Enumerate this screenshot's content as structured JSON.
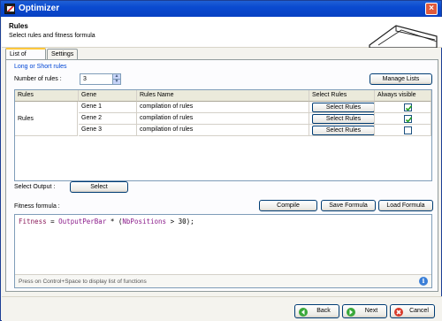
{
  "window": {
    "title": "Optimizer",
    "close_glyph": "×"
  },
  "header": {
    "title": "Rules",
    "subtitle": "Select rules and fitness formula"
  },
  "tabs": [
    {
      "label": "List of Rules"
    },
    {
      "label": "Settings"
    }
  ],
  "rules_section": {
    "group_label": "Long or Short rules",
    "number_label": "Number of rules :",
    "number_value": "3",
    "manage_lists_label": "Manage Lists"
  },
  "grid": {
    "columns": [
      "Rules",
      "Gene",
      "Rules Name",
      "Select Rules",
      "Always visible"
    ],
    "group_label": "Rules",
    "rows": [
      {
        "gene": "Gene 1",
        "name": "compilation of rules",
        "button": "Select Rules",
        "visible": true
      },
      {
        "gene": "Gene 2",
        "name": "compilation of rules",
        "button": "Select Rules",
        "visible": true
      },
      {
        "gene": "Gene 3",
        "name": "compilation of rules",
        "button": "Select Rules",
        "visible": false
      }
    ]
  },
  "output": {
    "label": "Select Output :",
    "button": "Select"
  },
  "fitness": {
    "label": "Fitness formula :",
    "compile_label": "Compile",
    "save_label": "Save Formula",
    "load_label": "Load Formula",
    "code": {
      "var1": "Fitness",
      "op1": " = ",
      "func": "OutputPerBar",
      "op2": " * (",
      "var2": "NbPositions",
      "op3": " > 30);"
    },
    "hint": "Press on Control+Space to display list of functions",
    "info_glyph": "i"
  },
  "footer": {
    "back_label": "Back",
    "next_label": "Next",
    "cancel_label": "Cancel",
    "back_icon_color": "#3aa83a",
    "next_icon_color": "#3aa83a",
    "cancel_icon_color": "#d83a2a"
  },
  "colors": {
    "titlebar": "#0a4ad0",
    "group_label": "#0046d5",
    "check": "#21a121"
  }
}
